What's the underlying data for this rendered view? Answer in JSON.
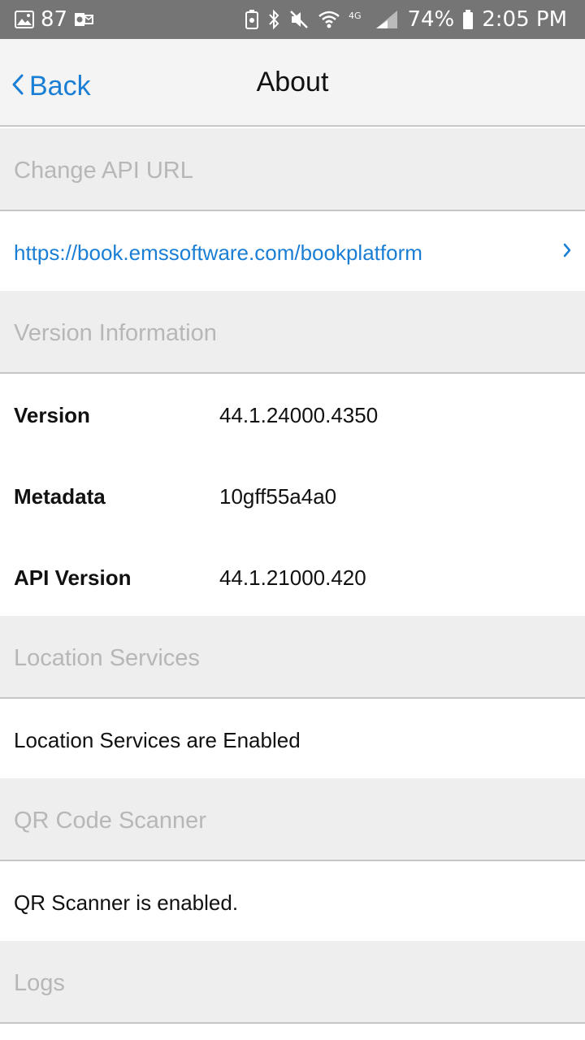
{
  "status_bar": {
    "notification_count": "87",
    "battery": "74%",
    "time": "2:05 PM",
    "network": "4G"
  },
  "nav": {
    "back_label": "Back",
    "title": "About"
  },
  "sections": {
    "api_url": {
      "header": "Change API URL",
      "url": "https://book.emssoftware.com/bookplatform"
    },
    "version_info": {
      "header": "Version Information",
      "rows": [
        {
          "key": "Version",
          "value": "44.1.24000.4350"
        },
        {
          "key": "Metadata",
          "value": "10gff55a4a0"
        },
        {
          "key": "API Version",
          "value": "44.1.21000.420"
        }
      ]
    },
    "location": {
      "header": "Location Services",
      "status": "Location Services are Enabled"
    },
    "qr": {
      "header": "QR Code Scanner",
      "status": "QR Scanner is enabled."
    },
    "logs": {
      "header": "Logs"
    }
  },
  "colors": {
    "accent": "#1a7fd4",
    "status_bar": "#757575",
    "section_bg": "#eeeeee",
    "section_text": "#b7b7b7"
  }
}
